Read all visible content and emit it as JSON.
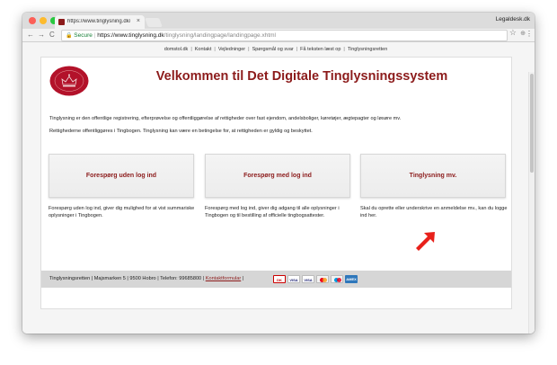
{
  "browser": {
    "tab_title": "https://www.tinglysning.dk/tin",
    "tab_close": "×",
    "profile_name": "Legaldesk.dk",
    "back_icon": "←",
    "forward_icon": "→",
    "reload_icon": "C",
    "secure_label": "Secure",
    "url_separator": "|",
    "url_scheme": "https://",
    "url_host": "www.tinglysning.dk",
    "url_path": "/tinglysning/landingpage/landingpage.xhtml",
    "star_icon": "☆",
    "extension_icon": "⊕",
    "menu_icon": "⋮"
  },
  "topnav": {
    "items": [
      "domstol.dk",
      "Kontakt",
      "Vejledninger",
      "Spørgsmål og svar",
      "Få teksten læst op",
      "Tinglysningsretten"
    ]
  },
  "page": {
    "heading": "Velkommen til Det Digitale Tinglysningssystem",
    "intro1": "Tinglysning er den offentlige registrering, efterprøvelse og offentliggørelse af rettigheder over fast ejendom, andelsboliger, køretøjer, ægtepagter og løsøre mv.",
    "intro2": "Rettighederne offentliggøres i Tingbogen. Tinglysning kan være en betingelse for, at rettigheden er gyldig og beskyttet."
  },
  "cards": [
    {
      "label": "Forespørg uden log ind",
      "description": "Forespørg uden log ind, giver dig mulighed for at vist summariske oplysninger i Tingbogen."
    },
    {
      "label": "Forespørg med log ind",
      "description": "Forespørg med log ind, giver dig adgang til alle oplysninger i Tingbogen og til bestilling af officielle tingbogsattester."
    },
    {
      "label": "Tinglysning mv.",
      "description": "Skal du oprette eller underskrive en anmeldelse mv., kan du logge ind her."
    }
  ],
  "footer": {
    "address": "Tinglysningsretten | Majsmarken 5 | 9500 Hobro | Telefon: 99685800 | ",
    "contact_link": "Kontaktformular",
    "after_link": " |",
    "payment_cards": [
      "DK",
      "VISA",
      "VISA",
      "",
      "",
      "AMEX"
    ]
  },
  "colors": {
    "brand_red": "#8c1b1b",
    "arrow_red": "#e8201a"
  }
}
